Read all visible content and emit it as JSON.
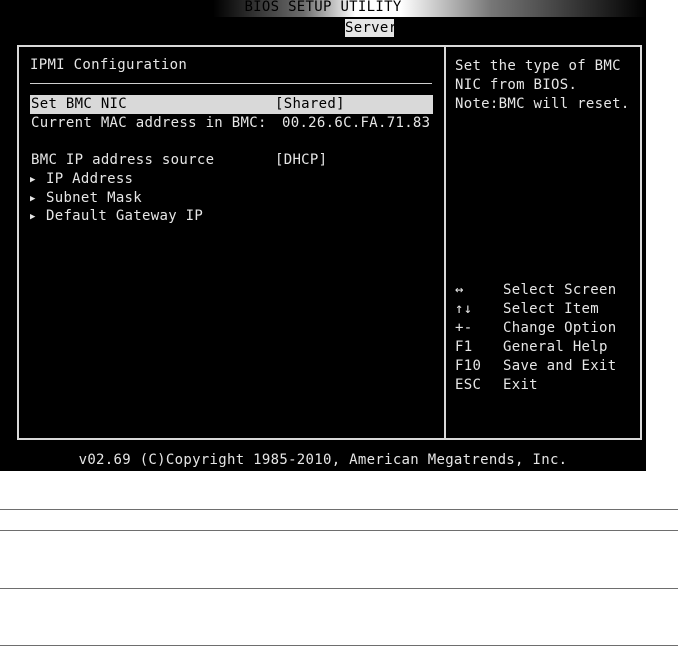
{
  "bios": {
    "title": "BIOS SETUP UTILITY",
    "active_tab": "Server",
    "section_title": "IPMI Configuration",
    "rows": [
      {
        "label": "Set BMC NIC",
        "value": "[Shared]"
      },
      {
        "label": "Current MAC address in BMC:",
        "value": "00.26.6C.FA.71.83"
      },
      {
        "label": "BMC IP address source",
        "value": "[DHCP]"
      }
    ],
    "submenus": [
      "IP Address",
      "Subnet Mask",
      "Default Gateway IP"
    ],
    "help": [
      "Set the type of BMC",
      "NIC from BIOS.",
      "Note:BMC will reset."
    ],
    "keys": [
      {
        "key": "↔",
        "desc": "Select Screen"
      },
      {
        "key": "↑↓",
        "desc": "Select Item"
      },
      {
        "key": "+-",
        "desc": "Change Option"
      },
      {
        "key": "F1",
        "desc": "General Help"
      },
      {
        "key": "F10",
        "desc": "Save and Exit"
      },
      {
        "key": "ESC",
        "desc": "Exit"
      }
    ],
    "footer": "v02.69 (C)Copyright 1985-2010, American Megatrends, Inc."
  }
}
